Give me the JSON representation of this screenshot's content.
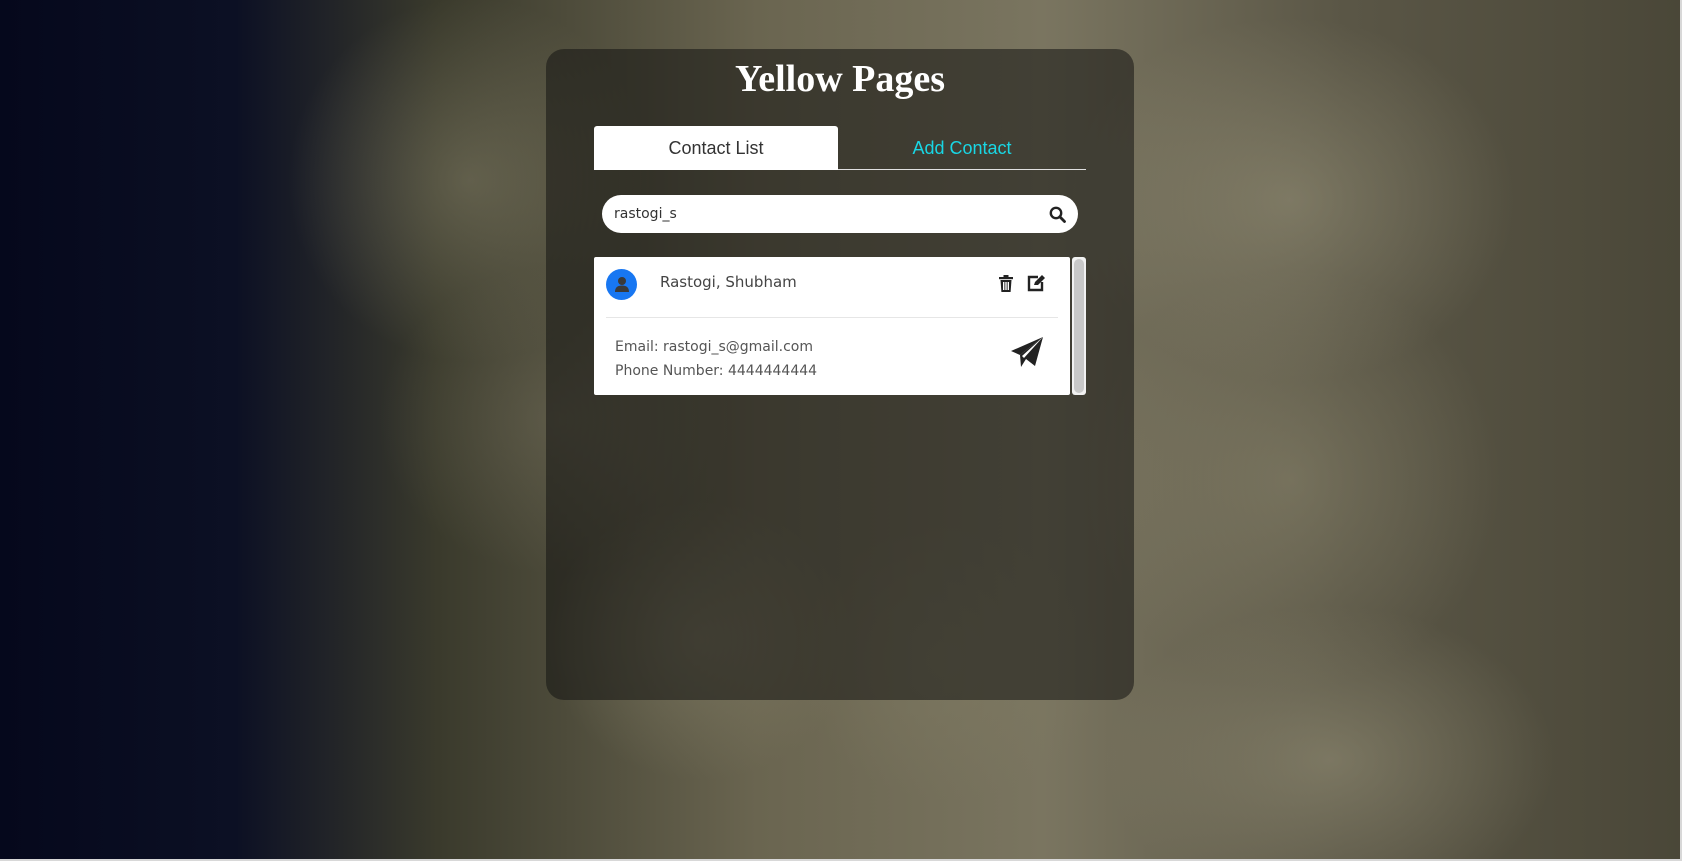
{
  "app": {
    "title": "Yellow Pages"
  },
  "tabs": [
    {
      "label": "Contact List",
      "active": true
    },
    {
      "label": "Add Contact",
      "active": false
    }
  ],
  "search": {
    "value": "rastogi_s",
    "icon": "search-icon"
  },
  "contacts": [
    {
      "name": "Rastogi,  Shubham",
      "email": "Email: rastogi_s@gmail.com",
      "phone": "Phone Number: 4444444444",
      "avatar_icon": "user-icon",
      "actions": [
        "trash-icon",
        "edit-icon"
      ],
      "send_icon": "paper-plane-icon"
    }
  ],
  "colors": {
    "accent_tab": "#19d6e4",
    "avatar": "#1877f2",
    "panel": "rgba(20,20,18,0.55)"
  }
}
